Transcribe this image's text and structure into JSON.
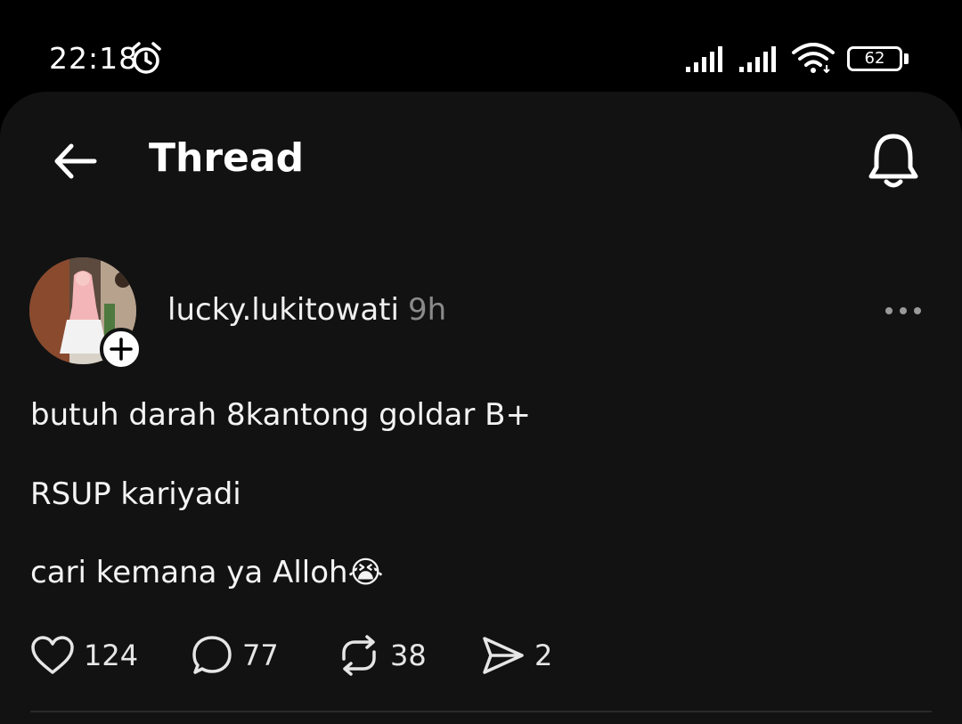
{
  "status_bar": {
    "time": "22:18",
    "battery": "62",
    "icons": [
      "alarm-icon",
      "cellular-signal-icon",
      "cellular-signal-icon",
      "wifi-icon",
      "battery-icon"
    ]
  },
  "header": {
    "title": "Thread",
    "back_icon": "arrow-left-icon",
    "notification_icon": "bell-icon"
  },
  "post": {
    "username": "lucky.lukitowati",
    "time_ago": "9h",
    "lines": [
      "butuh darah 8kantong goldar B+",
      "RSUP kariyadi",
      "cari kemana ya Alloh😭"
    ],
    "actions": {
      "likes": "124",
      "replies": "77",
      "reposts": "38",
      "shares": "2"
    }
  },
  "colors": {
    "background": "#000000",
    "sheet": "#121212",
    "text": "#f2f2f2",
    "muted": "#8a8a8a"
  }
}
